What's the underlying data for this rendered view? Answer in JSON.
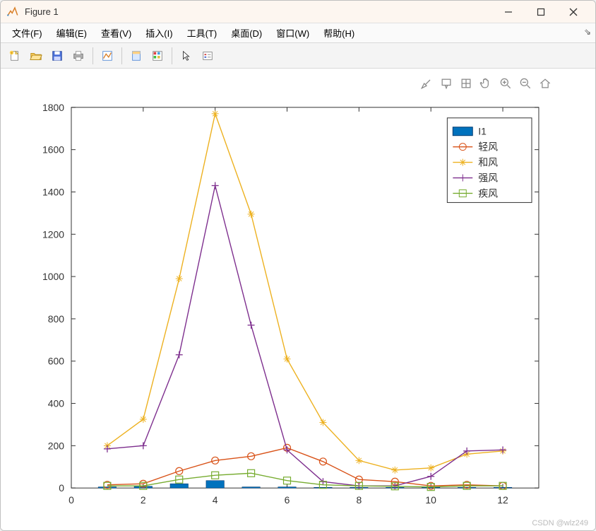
{
  "window": {
    "title": "Figure 1"
  },
  "menubar": {
    "items": [
      "文件(F)",
      "编辑(E)",
      "查看(V)",
      "插入(I)",
      "工具(T)",
      "桌面(D)",
      "窗口(W)",
      "帮助(H)"
    ]
  },
  "toolbar": {
    "new": "New Figure",
    "open": "Open",
    "save": "Save",
    "print": "Print",
    "link": "Link",
    "cursor": "Edit Plot",
    "colorbar": "Insert Colorbar",
    "pointer": "Pointer",
    "legend": "Insert Legend"
  },
  "axes_toolbar": {
    "brush": "Brush",
    "datatip": "Data Tip",
    "rotate": "Rotate",
    "pan": "Pan",
    "zoomin": "Zoom In",
    "zoomout": "Zoom Out",
    "home": "Restore View"
  },
  "legend": {
    "items": [
      "I1",
      "轻风",
      "和风",
      "强风",
      "疾风"
    ]
  },
  "watermark": "CSDN @wlz249",
  "chart_data": {
    "type": "line",
    "x": [
      1,
      2,
      3,
      4,
      5,
      6,
      7,
      8,
      9,
      10,
      11,
      12
    ],
    "xlim": [
      0,
      13
    ],
    "ylim": [
      0,
      1800
    ],
    "xticks": [
      0,
      2,
      4,
      6,
      8,
      10,
      12
    ],
    "yticks": [
      0,
      200,
      400,
      600,
      800,
      1000,
      1200,
      1400,
      1600,
      1800
    ],
    "series": [
      {
        "name": "I1",
        "type": "bar",
        "color": "#0072bd",
        "values": [
          5,
          8,
          20,
          35,
          5,
          5,
          3,
          3,
          3,
          3,
          3,
          3
        ]
      },
      {
        "name": "轻风",
        "type": "line",
        "color": "#d95319",
        "marker": "o",
        "values": [
          15,
          20,
          80,
          130,
          150,
          190,
          125,
          40,
          30,
          10,
          15,
          10
        ]
      },
      {
        "name": "和风",
        "type": "line",
        "color": "#edb120",
        "marker": "*",
        "values": [
          200,
          325,
          990,
          1770,
          1295,
          610,
          310,
          130,
          85,
          95,
          160,
          175
        ]
      },
      {
        "name": "强风",
        "type": "line",
        "color": "#7e2f8e",
        "marker": "+",
        "values": [
          185,
          200,
          630,
          1430,
          770,
          180,
          30,
          10,
          10,
          55,
          175,
          180
        ]
      },
      {
        "name": "疾风",
        "type": "line",
        "color": "#77ac30",
        "marker": "s",
        "values": [
          10,
          10,
          40,
          60,
          70,
          35,
          15,
          10,
          8,
          5,
          10,
          10
        ]
      }
    ]
  }
}
